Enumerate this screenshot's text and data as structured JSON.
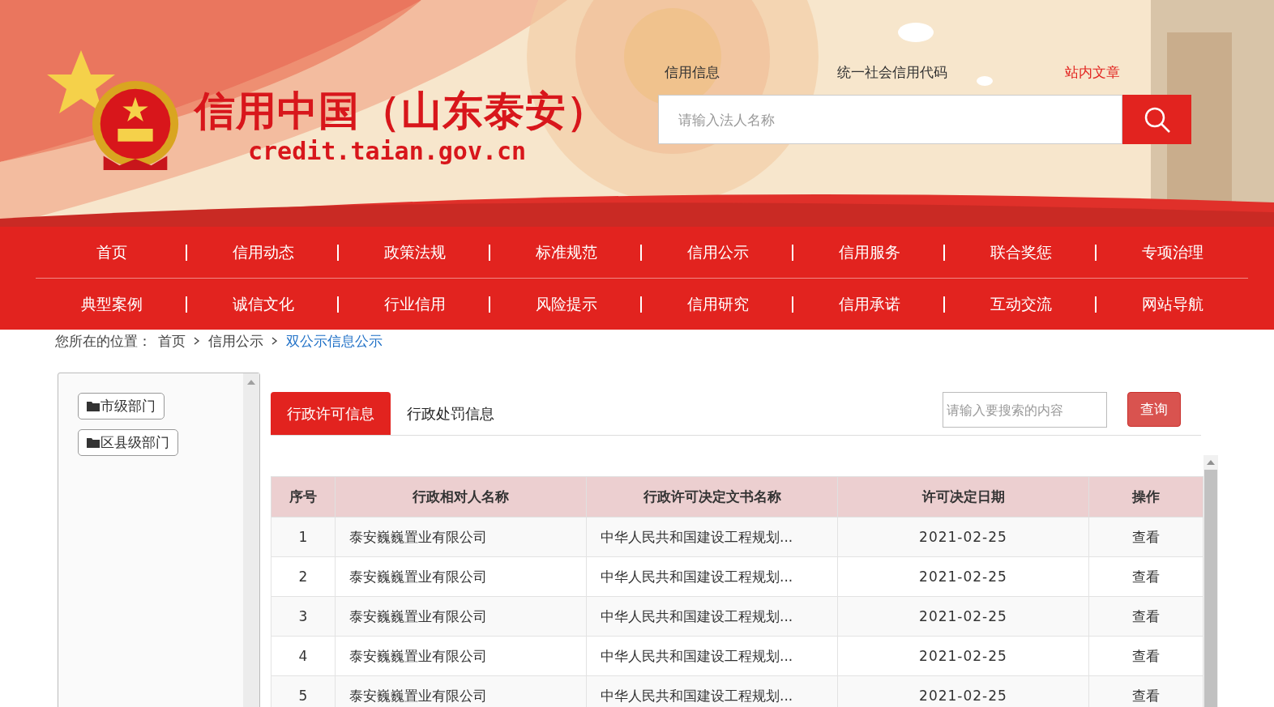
{
  "header": {
    "site_title": "信用中国（山东泰安）",
    "site_url": "credit.taian.gov.cn",
    "search_types": [
      {
        "label": "信用信息",
        "selected": false
      },
      {
        "label": "统一社会信用代码",
        "selected": false
      },
      {
        "label": "站内文章",
        "selected": true
      }
    ],
    "search": {
      "placeholder": "请输入法人名称"
    }
  },
  "nav": {
    "rows": [
      [
        "首页",
        "信用动态",
        "政策法规",
        "标准规范",
        "信用公示",
        "信用服务",
        "联合奖惩",
        "专项治理"
      ],
      [
        "典型案例",
        "诚信文化",
        "行业信用",
        "风险提示",
        "信用研究",
        "信用承诺",
        "互动交流",
        "网站导航"
      ]
    ]
  },
  "breadcrumb": {
    "label": "您所在的位置：",
    "items": [
      {
        "text": "首页",
        "current": false
      },
      {
        "text": "信用公示",
        "current": false
      },
      {
        "text": "双公示信息公示",
        "current": true
      }
    ]
  },
  "sidebar": {
    "items": [
      "市级部门",
      "区县级部门"
    ]
  },
  "tabs": [
    {
      "label": "行政许可信息",
      "selected": true
    },
    {
      "label": "行政处罚信息",
      "selected": false
    }
  ],
  "filter": {
    "placeholder": "请输入要搜索的内容",
    "button": "查询"
  },
  "table": {
    "columns": [
      "序号",
      "行政相对人名称",
      "行政许可决定文书名称",
      "许可决定日期",
      "操作"
    ],
    "rows": [
      [
        "1",
        "泰安巍巍置业有限公司",
        "中华人民共和国建设工程规划...",
        "2021-02-25",
        "查看"
      ],
      [
        "2",
        "泰安巍巍置业有限公司",
        "中华人民共和国建设工程规划...",
        "2021-02-25",
        "查看"
      ],
      [
        "3",
        "泰安巍巍置业有限公司",
        "中华人民共和国建设工程规划...",
        "2021-02-25",
        "查看"
      ],
      [
        "4",
        "泰安巍巍置业有限公司",
        "中华人民共和国建设工程规划...",
        "2021-02-25",
        "查看"
      ],
      [
        "5",
        "泰安巍巍置业有限公司",
        "中华人民共和国建设工程规划...",
        "2021-02-25",
        "查看"
      ]
    ]
  }
}
